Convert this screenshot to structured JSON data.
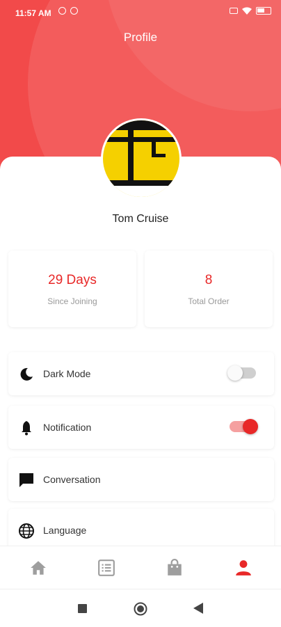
{
  "status_bar": {
    "time": "11:57 AM"
  },
  "header": {
    "title": "Profile"
  },
  "user": {
    "name": "Tom Cruise"
  },
  "stats": [
    {
      "value": "29 Days",
      "label": "Since Joining"
    },
    {
      "value": "8",
      "label": "Total Order"
    }
  ],
  "settings": [
    {
      "label": "Dark Mode",
      "icon": "moon-icon",
      "toggle": false
    },
    {
      "label": "Notification",
      "icon": "bell-icon",
      "toggle": true
    },
    {
      "label": "Conversation",
      "icon": "chat-icon"
    },
    {
      "label": "Language",
      "icon": "globe-icon"
    }
  ],
  "bottom_nav": [
    {
      "icon": "home-icon",
      "active": false
    },
    {
      "icon": "list-icon",
      "active": false
    },
    {
      "icon": "bag-icon",
      "active": false
    },
    {
      "icon": "profile-icon",
      "active": true
    }
  ],
  "colors": {
    "accent": "#e82828",
    "header": "#f24a4a",
    "inactive": "#9e9e9e",
    "avatar_bg": "#f5d000"
  }
}
